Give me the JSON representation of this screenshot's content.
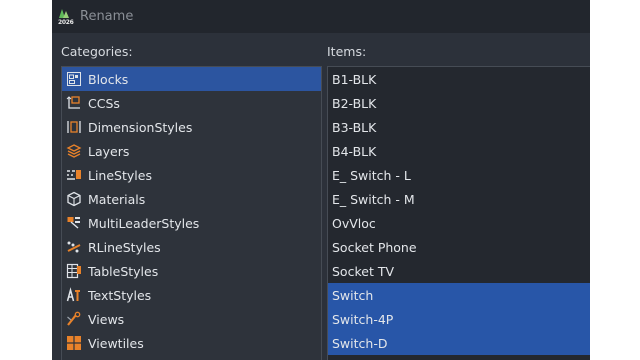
{
  "window": {
    "title": "Rename",
    "logo_text": "2026"
  },
  "categories": {
    "label": "Categories:",
    "selected_index": 0,
    "items": [
      {
        "label": "Blocks",
        "icon": "block-icon"
      },
      {
        "label": "CCSs",
        "icon": "ccs-icon"
      },
      {
        "label": "DimensionStyles",
        "icon": "dimension-style-icon"
      },
      {
        "label": "Layers",
        "icon": "layers-icon"
      },
      {
        "label": "LineStyles",
        "icon": "linestyle-icon"
      },
      {
        "label": "Materials",
        "icon": "materials-icon"
      },
      {
        "label": "MultiLeaderStyles",
        "icon": "multileader-style-icon"
      },
      {
        "label": "RLineStyles",
        "icon": "rlinestyle-icon"
      },
      {
        "label": "TableStyles",
        "icon": "tablestyle-icon"
      },
      {
        "label": "TextStyles",
        "icon": "textstyle-icon"
      },
      {
        "label": "Views",
        "icon": "views-icon"
      },
      {
        "label": "Viewtiles",
        "icon": "viewtiles-icon"
      }
    ]
  },
  "items": {
    "label": "Items:",
    "rows": [
      {
        "label": "B1-BLK",
        "selected": false
      },
      {
        "label": "B2-BLK",
        "selected": false
      },
      {
        "label": "B3-BLK",
        "selected": false
      },
      {
        "label": "B4-BLK",
        "selected": false
      },
      {
        "label": "E_ Switch - L",
        "selected": false
      },
      {
        "label": "E_ Switch - M",
        "selected": false
      },
      {
        "label": "OvVloc",
        "selected": false
      },
      {
        "label": "Socket Phone",
        "selected": false
      },
      {
        "label": "Socket TV",
        "selected": false
      },
      {
        "label": "Switch",
        "selected": true
      },
      {
        "label": "Switch-4P",
        "selected": true
      },
      {
        "label": "Switch-D",
        "selected": true
      }
    ]
  },
  "colors": {
    "accent": "#e8822a",
    "selection": "#2856a8",
    "background": "#2c313a"
  }
}
